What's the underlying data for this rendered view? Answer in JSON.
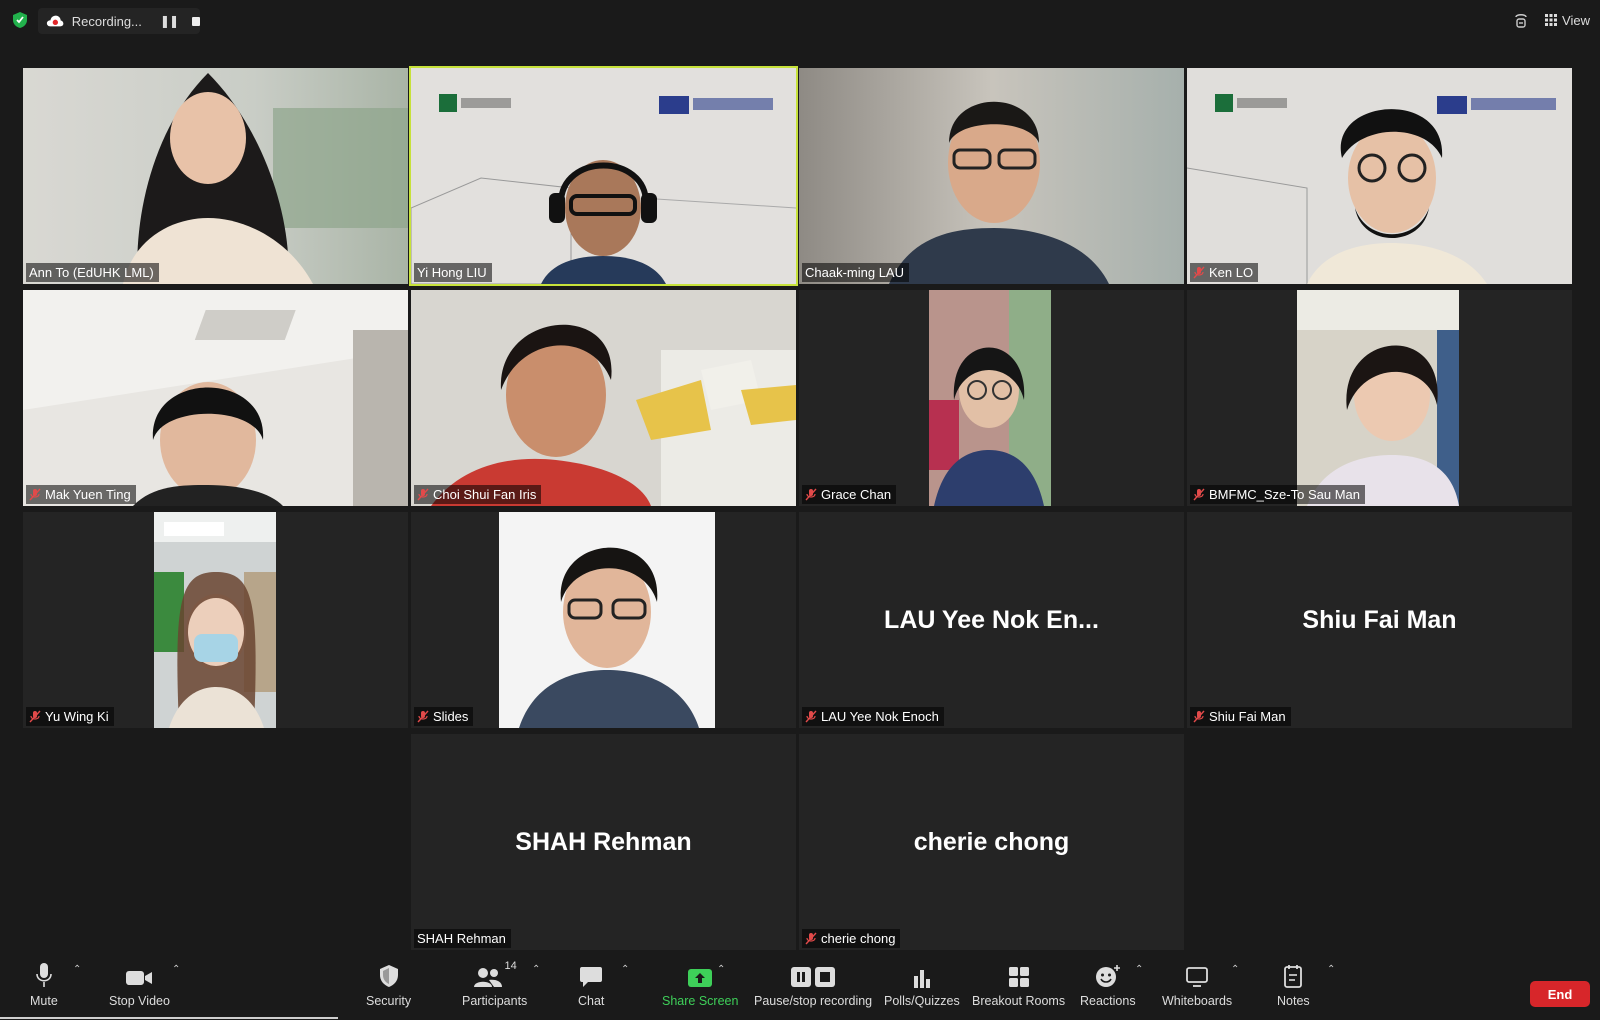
{
  "topbar": {
    "recording_label": "Recording...",
    "view_label": "View"
  },
  "tiles": [
    {
      "name": "Ann To (EdUHK LML)",
      "muted": false
    },
    {
      "name": "Yi Hong LIU",
      "muted": false
    },
    {
      "name": "Chaak-ming LAU",
      "muted": false
    },
    {
      "name": "Ken LO",
      "muted": true
    },
    {
      "name": "Mak Yuen Ting",
      "muted": true
    },
    {
      "name": "Choi Shui Fan Iris",
      "muted": true
    },
    {
      "name": "Grace Chan",
      "muted": true
    },
    {
      "name": "BMFMC_Sze-To Sau Man",
      "muted": true
    },
    {
      "name": "Yu Wing Ki",
      "muted": true
    },
    {
      "name": "Slides",
      "muted": true
    },
    {
      "name": "LAU Yee Nok Enoch",
      "display": "LAU Yee Nok En...",
      "muted": true
    },
    {
      "name": "Shiu Fai Man",
      "display": "Shiu Fai Man",
      "muted": true
    },
    {
      "name": "SHAH Rehman",
      "display": "SHAH Rehman",
      "muted": false
    },
    {
      "name": "cherie chong",
      "display": "cherie chong",
      "muted": true
    }
  ],
  "toolbar": {
    "mute": "Mute",
    "stop_video": "Stop Video",
    "security": "Security",
    "participants": "Participants",
    "participants_count": "14",
    "chat": "Chat",
    "share_screen": "Share Screen",
    "pause_stop_recording": "Pause/stop recording",
    "polls": "Polls/Quizzes",
    "breakout": "Breakout Rooms",
    "reactions": "Reactions",
    "whiteboards": "Whiteboards",
    "notes": "Notes",
    "end": "End"
  },
  "colors": {
    "active_speaker": "#c7e23a",
    "share_green": "#3ecf59",
    "end_red": "#d7262a",
    "muted_red": "#e24a4a"
  }
}
